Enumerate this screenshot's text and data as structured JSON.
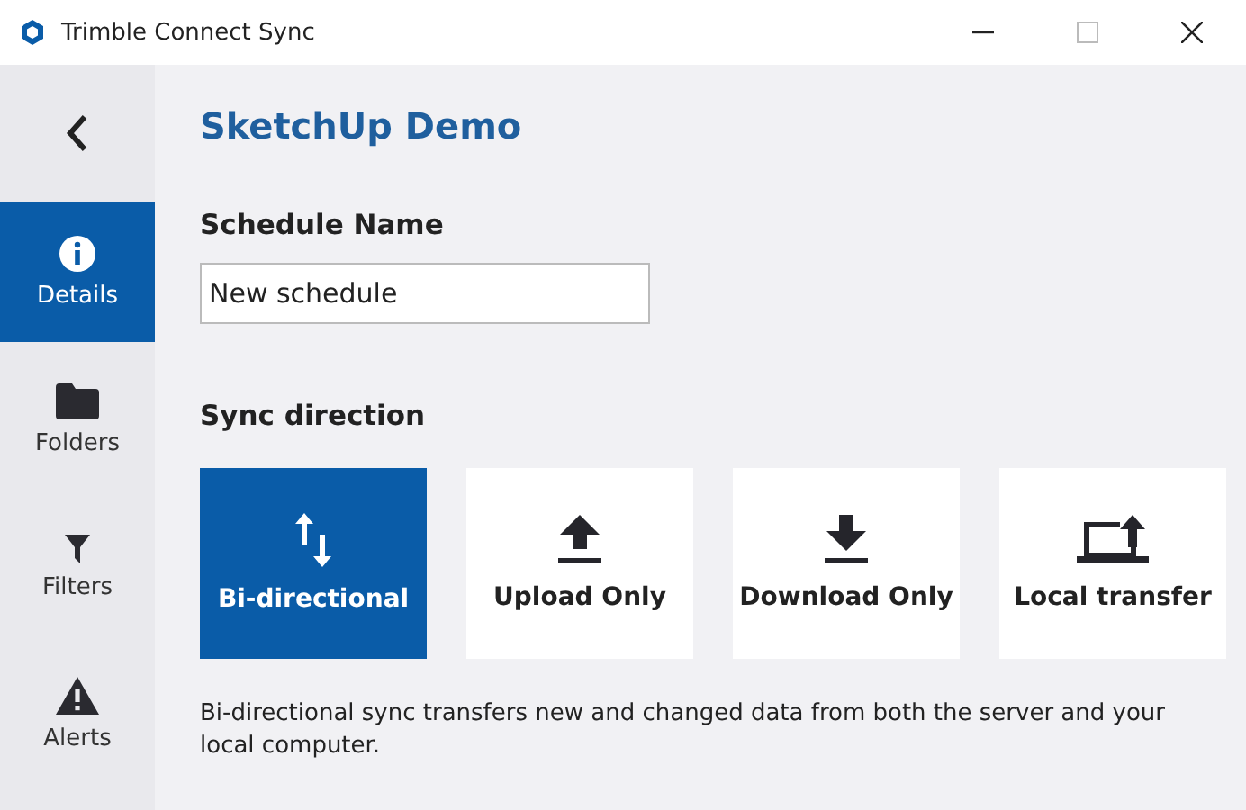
{
  "window": {
    "title": "Trimble Connect Sync"
  },
  "project_title": "SketchUp Demo",
  "sidebar": {
    "items": [
      {
        "label": "Details",
        "kind": "info",
        "selected": true
      },
      {
        "label": "Folders",
        "kind": "folder",
        "selected": false
      },
      {
        "label": "Filters",
        "kind": "filter",
        "selected": false
      },
      {
        "label": "Alerts",
        "kind": "alert",
        "selected": false
      }
    ]
  },
  "schedule_name": {
    "label": "Schedule Name",
    "value": "New schedule"
  },
  "sync_direction": {
    "label": "Sync direction",
    "options": [
      {
        "label": "Bi-directional",
        "kind": "bidirectional",
        "selected": true
      },
      {
        "label": "Upload Only",
        "kind": "upload",
        "selected": false
      },
      {
        "label": "Download Only",
        "kind": "download",
        "selected": false
      },
      {
        "label": "Local transfer",
        "kind": "local",
        "selected": false
      }
    ],
    "description": "Bi-directional sync transfers new and changed data from both the server and your local computer."
  }
}
